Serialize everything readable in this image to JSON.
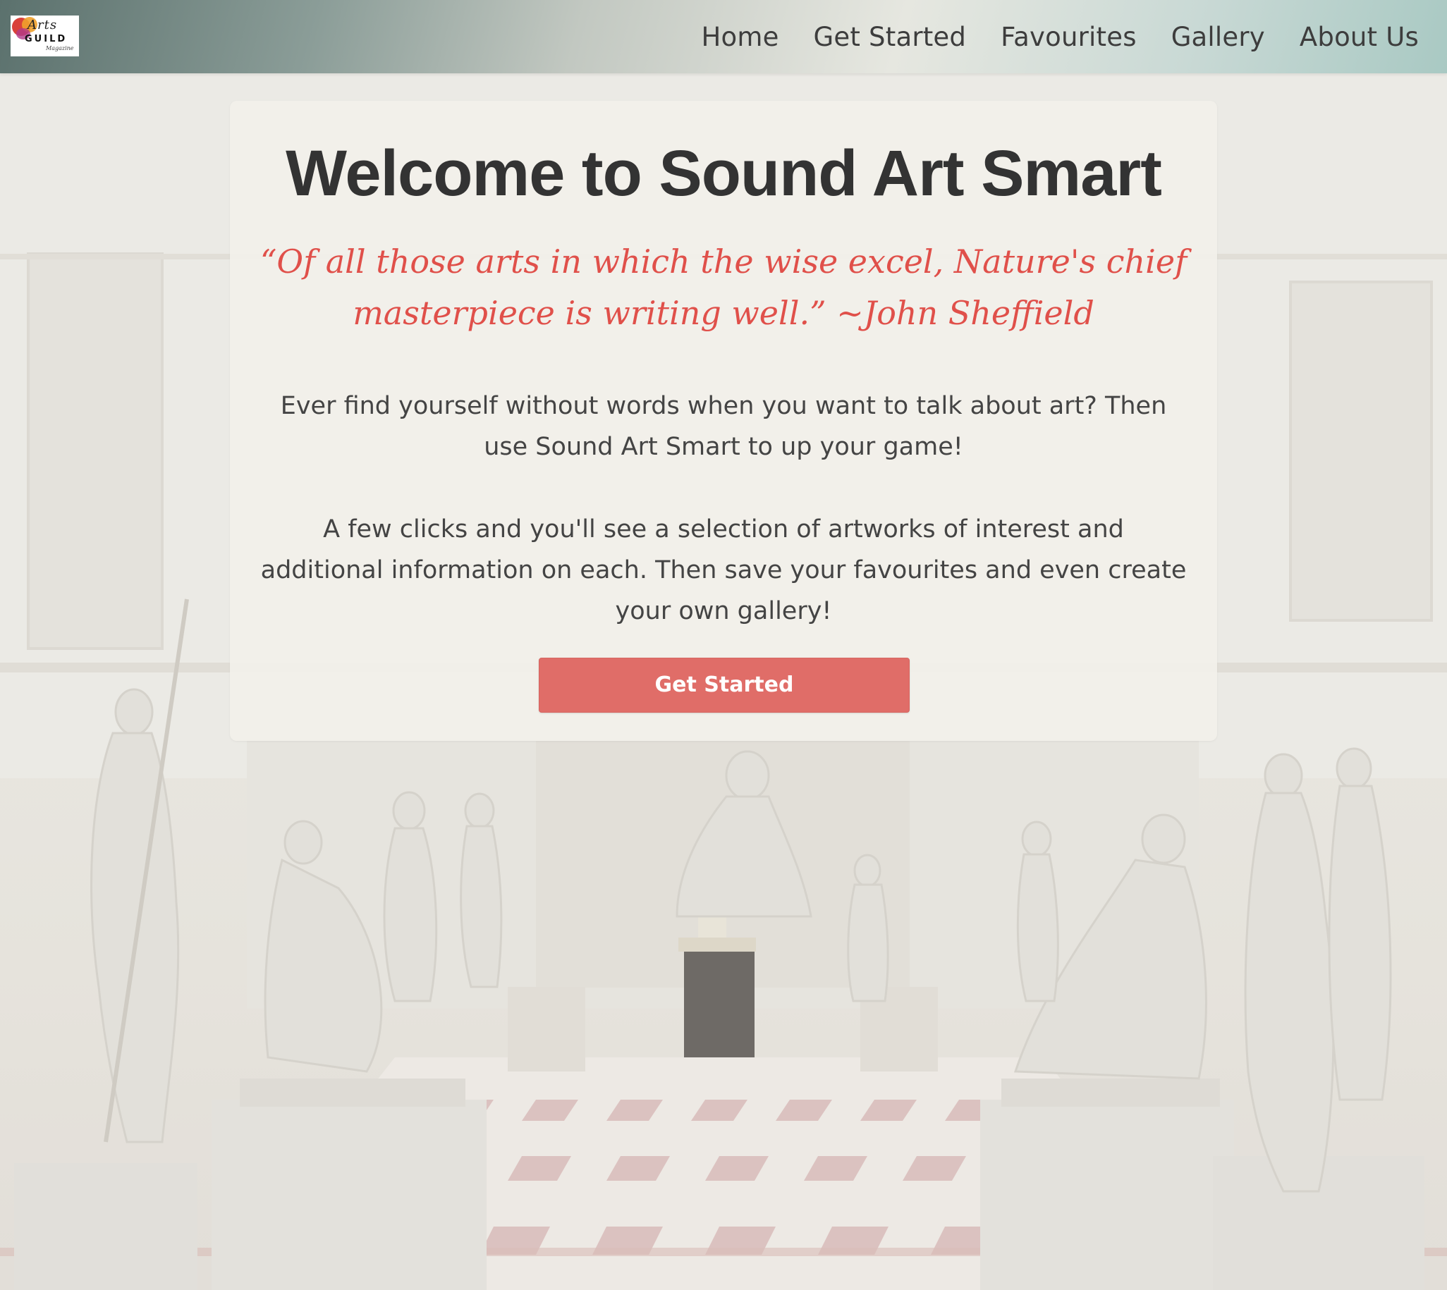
{
  "navbar": {
    "logo": {
      "line1": "Arts",
      "line2": "GUILD",
      "line3": "Magazine"
    },
    "links": [
      "Home",
      "Get Started",
      "Favourites",
      "Gallery",
      "About Us"
    ]
  },
  "hero": {
    "title": "Welcome to Sound Art Smart",
    "quote": "“Of all those arts in which the wise excel, Nature's chief masterpiece is writing well.” ~John Sheffield",
    "paragraph1": "Ever find yourself without words when you want to talk about art? Then use Sound Art Smart to up your game!",
    "paragraph2": "A few clicks and you'll see a selection of artworks of interest and additional information on each. Then save your favourites and even create your own gallery!",
    "cta_label": "Get Started"
  },
  "colors": {
    "accent": "#e06d68",
    "quote": "#e0504a",
    "title": "#333333",
    "body_text": "#444444"
  }
}
